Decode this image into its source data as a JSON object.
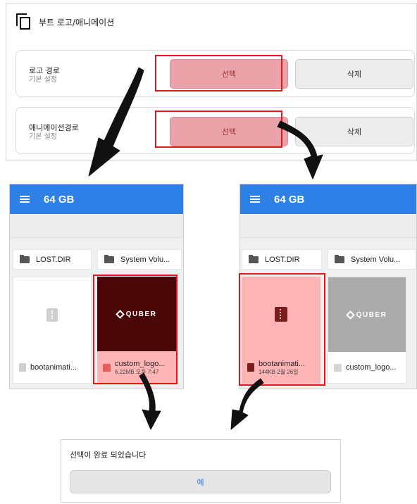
{
  "settings": {
    "title": "부트 로고/애니메이션",
    "rows": [
      {
        "label": "로고 경로",
        "sub": "기본 설정",
        "select_label": "선택",
        "delete_label": "삭제"
      },
      {
        "label": "애니메이션경로",
        "sub": "기본 설정",
        "select_label": "선택",
        "delete_label": "삭제"
      }
    ]
  },
  "file_browser_left": {
    "title": "64 GB",
    "folders": [
      "LOST.DIR",
      "System Volu..."
    ],
    "files": [
      {
        "name": "bootanimati...",
        "meta": ""
      },
      {
        "name": "custom_logo...",
        "meta": "6.22MB 오후 7:47",
        "brand": "QUBER"
      }
    ]
  },
  "file_browser_right": {
    "title": "64 GB",
    "folders": [
      "LOST.DIR",
      "System Volu..."
    ],
    "files": [
      {
        "name": "bootanimati...",
        "meta": "144KB 2월 26일"
      },
      {
        "name": "custom_logo...",
        "meta": "",
        "brand": "QUBER"
      }
    ]
  },
  "dialog": {
    "message": "선택이 완료 되었습니다",
    "ok_label": "예"
  },
  "colors": {
    "appbar": "#2f80e6",
    "highlight": "#e01818",
    "select_button": "#eaa3a8",
    "selected_tile": "#ffb5b5"
  }
}
